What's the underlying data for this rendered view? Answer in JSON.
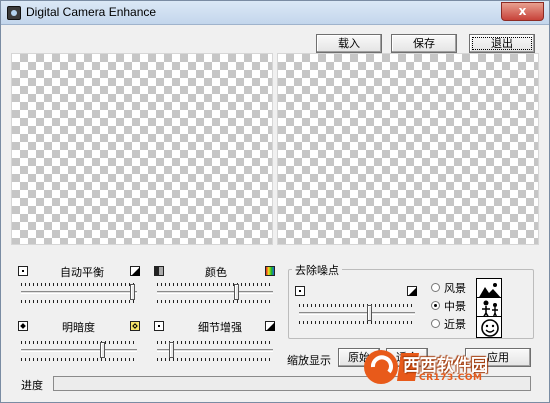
{
  "window": {
    "title": "Digital Camera Enhance",
    "close_glyph": "x"
  },
  "toolbar": {
    "load_label": "载入",
    "save_label": "保存",
    "exit_label": "退出"
  },
  "adjustments": {
    "white_balance": {
      "label": "自动平衡",
      "value": 0.96
    },
    "color": {
      "label": "颜色",
      "value": 0.68
    },
    "brightness": {
      "label": "明暗度",
      "value": 0.7
    },
    "detail": {
      "label": "细节增强",
      "value": 0.12
    }
  },
  "denoise": {
    "title": "去除噪点",
    "value": 0.6,
    "options": [
      {
        "label": "风景",
        "checked": false
      },
      {
        "label": "中景",
        "checked": true
      },
      {
        "label": "近景",
        "checked": false
      }
    ]
  },
  "zoom": {
    "label": "缩放显示",
    "original_label": "原始",
    "fit_label": "适合",
    "apply_label": "应用"
  },
  "progress": {
    "label": "进度"
  },
  "watermark": {
    "brand": "西西软件园",
    "url": "CR173.COM"
  },
  "icons": {
    "app": "camera-icon",
    "scenes": [
      "mountain-landscape-icon",
      "people-midshot-icon",
      "face-closeup-icon"
    ]
  }
}
